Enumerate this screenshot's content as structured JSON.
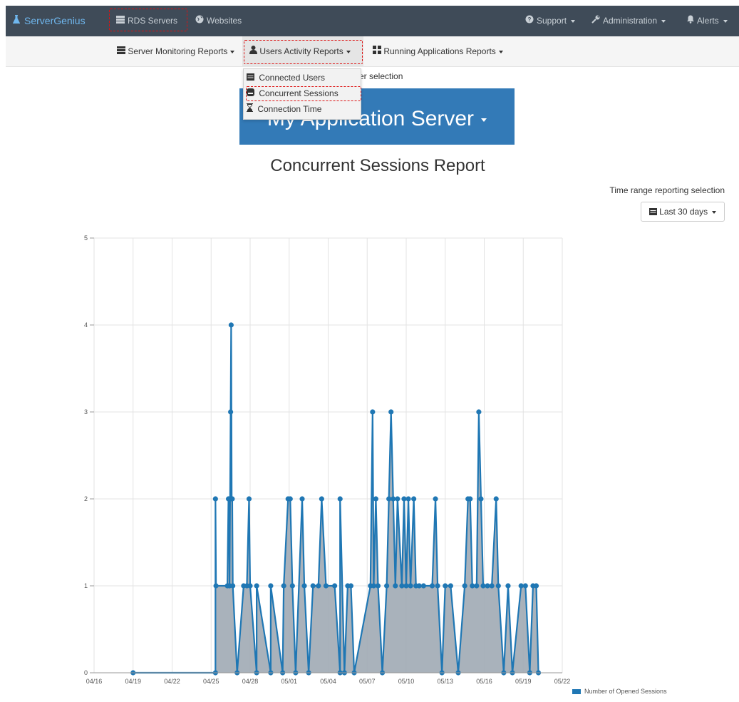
{
  "topbar": {
    "brand": "ServerGenius",
    "brand_icon": "flask-icon",
    "nav": [
      {
        "label": "RDS Servers",
        "icon": "server-icon"
      },
      {
        "label": "Websites",
        "icon": "globe-icon"
      }
    ],
    "right": [
      {
        "label": "Support",
        "icon": "question-circle-icon"
      },
      {
        "label": "Administration",
        "icon": "wrench-icon"
      },
      {
        "label": "Alerts",
        "icon": "bell-icon"
      }
    ]
  },
  "subnav": {
    "items": [
      {
        "label": "Server Monitoring Reports",
        "icon": "server-icon"
      },
      {
        "label": "Users Activity Reports",
        "icon": "user-icon"
      },
      {
        "label": "Running Applications Reports",
        "icon": "grid-icon"
      }
    ]
  },
  "dropdown": {
    "items": [
      {
        "label": "Connected Users",
        "icon": "calendar-icon"
      },
      {
        "label": "Concurrent Sessions",
        "icon": "hdd-icon"
      },
      {
        "label": "Connection Time",
        "icon": "hourglass-icon"
      }
    ]
  },
  "main": {
    "server_selection_label": "ver selection",
    "server_name": "My Application Server",
    "report_title": "Concurrent Sessions Report",
    "time_range_label": "Time range reporting selection",
    "time_range_value": "Last 30 days"
  },
  "colors": {
    "topbar": "#3f4b58",
    "brand": "#6fb7ee",
    "banner": "#337ab7",
    "series": "#1f77b4",
    "fill": "#a0aab4",
    "highlight": "#dd1111"
  },
  "chart_data": {
    "type": "line",
    "title": "",
    "xlabel": "",
    "ylabel": "",
    "ylim": [
      0,
      5
    ],
    "yticks": [
      0,
      1,
      2,
      3,
      4,
      5
    ],
    "xlim": [
      "04/16",
      "05/22"
    ],
    "xticks": [
      "04/16",
      "04/19",
      "04/22",
      "04/25",
      "04/28",
      "05/01",
      "05/04",
      "05/07",
      "05/10",
      "05/13",
      "05/16",
      "05/19",
      "05/22"
    ],
    "grid": true,
    "legend_position": "right",
    "series": [
      {
        "name": "Number of Opened Sessions",
        "points": [
          [
            "04/19 00:00",
            0
          ],
          [
            "04/25 08:00",
            0
          ],
          [
            "04/25 08:00",
            2
          ],
          [
            "04/25 09:00",
            1
          ],
          [
            "04/26 06:00",
            1
          ],
          [
            "04/26 08:00",
            2
          ],
          [
            "04/26 09:00",
            2
          ],
          [
            "04/26 10:00",
            1
          ],
          [
            "04/26 12:00",
            3
          ],
          [
            "04/26 13:00",
            4
          ],
          [
            "04/26 14:00",
            2
          ],
          [
            "04/26 15:00",
            2
          ],
          [
            "04/26 16:00",
            1
          ],
          [
            "04/27 00:00",
            0
          ],
          [
            "04/27 12:00",
            1
          ],
          [
            "04/27 18:00",
            1
          ],
          [
            "04/27 22:00",
            2
          ],
          [
            "04/28 00:00",
            1
          ],
          [
            "04/28 12:00",
            0
          ],
          [
            "04/28 12:00",
            1
          ],
          [
            "04/29 14:00",
            0
          ],
          [
            "04/29 14:00",
            1
          ],
          [
            "04/30 12:00",
            0
          ],
          [
            "04/30 14:00",
            1
          ],
          [
            "04/30 22:00",
            2
          ],
          [
            "05/01 02:00",
            2
          ],
          [
            "05/01 06:00",
            1
          ],
          [
            "05/01 12:00",
            0
          ],
          [
            "05/02 00:00",
            2
          ],
          [
            "05/02 04:00",
            1
          ],
          [
            "05/02 12:00",
            0
          ],
          [
            "05/02 20:00",
            1
          ],
          [
            "05/03 06:00",
            1
          ],
          [
            "05/03 12:00",
            2
          ],
          [
            "05/03 20:00",
            1
          ],
          [
            "05/04 12:00",
            1
          ],
          [
            "05/04 22:00",
            0
          ],
          [
            "05/04 22:00",
            2
          ],
          [
            "05/05 06:00",
            0
          ],
          [
            "05/05 12:00",
            1
          ],
          [
            "05/05 18:00",
            1
          ],
          [
            "05/06 00:00",
            0
          ],
          [
            "05/07 06:00",
            1
          ],
          [
            "05/07 10:00",
            3
          ],
          [
            "05/07 12:00",
            1
          ],
          [
            "05/07 16:00",
            2
          ],
          [
            "05/07 20:00",
            1
          ],
          [
            "05/08 04:00",
            0
          ],
          [
            "05/08 12:00",
            1
          ],
          [
            "05/08 16:00",
            2
          ],
          [
            "05/08 20:00",
            3
          ],
          [
            "05/09 00:00",
            2
          ],
          [
            "05/09 04:00",
            1
          ],
          [
            "05/09 08:00",
            2
          ],
          [
            "05/09 16:00",
            1
          ],
          [
            "05/09 20:00",
            2
          ],
          [
            "05/10 00:00",
            1
          ],
          [
            "05/10 04:00",
            2
          ],
          [
            "05/10 08:00",
            1
          ],
          [
            "05/10 14:00",
            2
          ],
          [
            "05/10 18:00",
            1
          ],
          [
            "05/11 00:00",
            1
          ],
          [
            "05/11 08:00",
            1
          ],
          [
            "05/12 00:00",
            1
          ],
          [
            "05/12 06:00",
            2
          ],
          [
            "05/12 10:00",
            1
          ],
          [
            "05/12 18:00",
            0
          ],
          [
            "05/13 00:00",
            1
          ],
          [
            "05/13 10:00",
            1
          ],
          [
            "05/14 00:00",
            0
          ],
          [
            "05/14 12:00",
            1
          ],
          [
            "05/14 18:00",
            2
          ],
          [
            "05/14 22:00",
            2
          ],
          [
            "05/15 02:00",
            1
          ],
          [
            "05/15 10:00",
            1
          ],
          [
            "05/15 14:00",
            3
          ],
          [
            "05/15 18:00",
            2
          ],
          [
            "05/15 22:00",
            1
          ],
          [
            "05/16 06:00",
            1
          ],
          [
            "05/16 14:00",
            1
          ],
          [
            "05/16 22:00",
            2
          ],
          [
            "05/17 02:00",
            1
          ],
          [
            "05/17 12:00",
            0
          ],
          [
            "05/17 20:00",
            1
          ],
          [
            "05/18 04:00",
            0
          ],
          [
            "05/18 20:00",
            1
          ],
          [
            "05/19 04:00",
            1
          ],
          [
            "05/19 12:00",
            0
          ],
          [
            "05/19 18:00",
            1
          ],
          [
            "05/20 00:00",
            1
          ],
          [
            "05/20 04:00",
            0
          ]
        ]
      }
    ]
  }
}
